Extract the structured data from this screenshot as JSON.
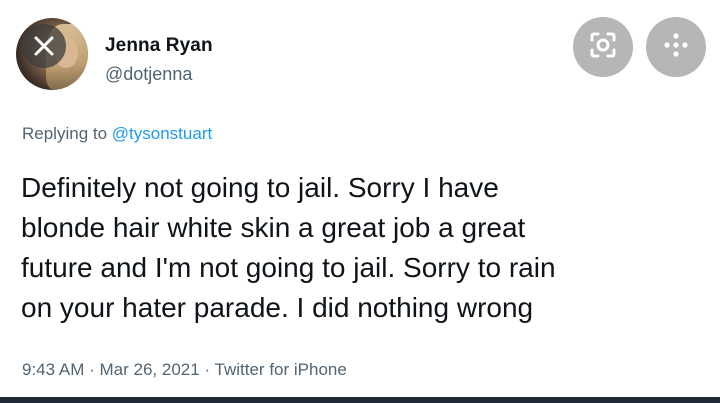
{
  "user": {
    "display_name": "Jenna Ryan",
    "handle": "@dotjenna"
  },
  "header": {
    "close_icon": "close-icon",
    "lens_icon": "lens-icon",
    "more_icon": "more-icon"
  },
  "reply": {
    "prefix": "Replying to",
    "mention": "@tysonstuart"
  },
  "tweet": {
    "lines": [
      "Definitely not going to jail. Sorry I have",
      "blonde hair white skin a great job a great",
      "future and I'm not going to jail. Sorry to rain",
      "on your hater parade. I did nothing wrong"
    ]
  },
  "meta": {
    "time": "9:43 AM",
    "date": "Mar 26, 2021",
    "source": "Twitter for iPhone",
    "separator": "·"
  },
  "colors": {
    "text": "#0f1419",
    "secondary": "#536471",
    "link": "#1d9bf0",
    "button_bg": "#b4b6b7"
  }
}
